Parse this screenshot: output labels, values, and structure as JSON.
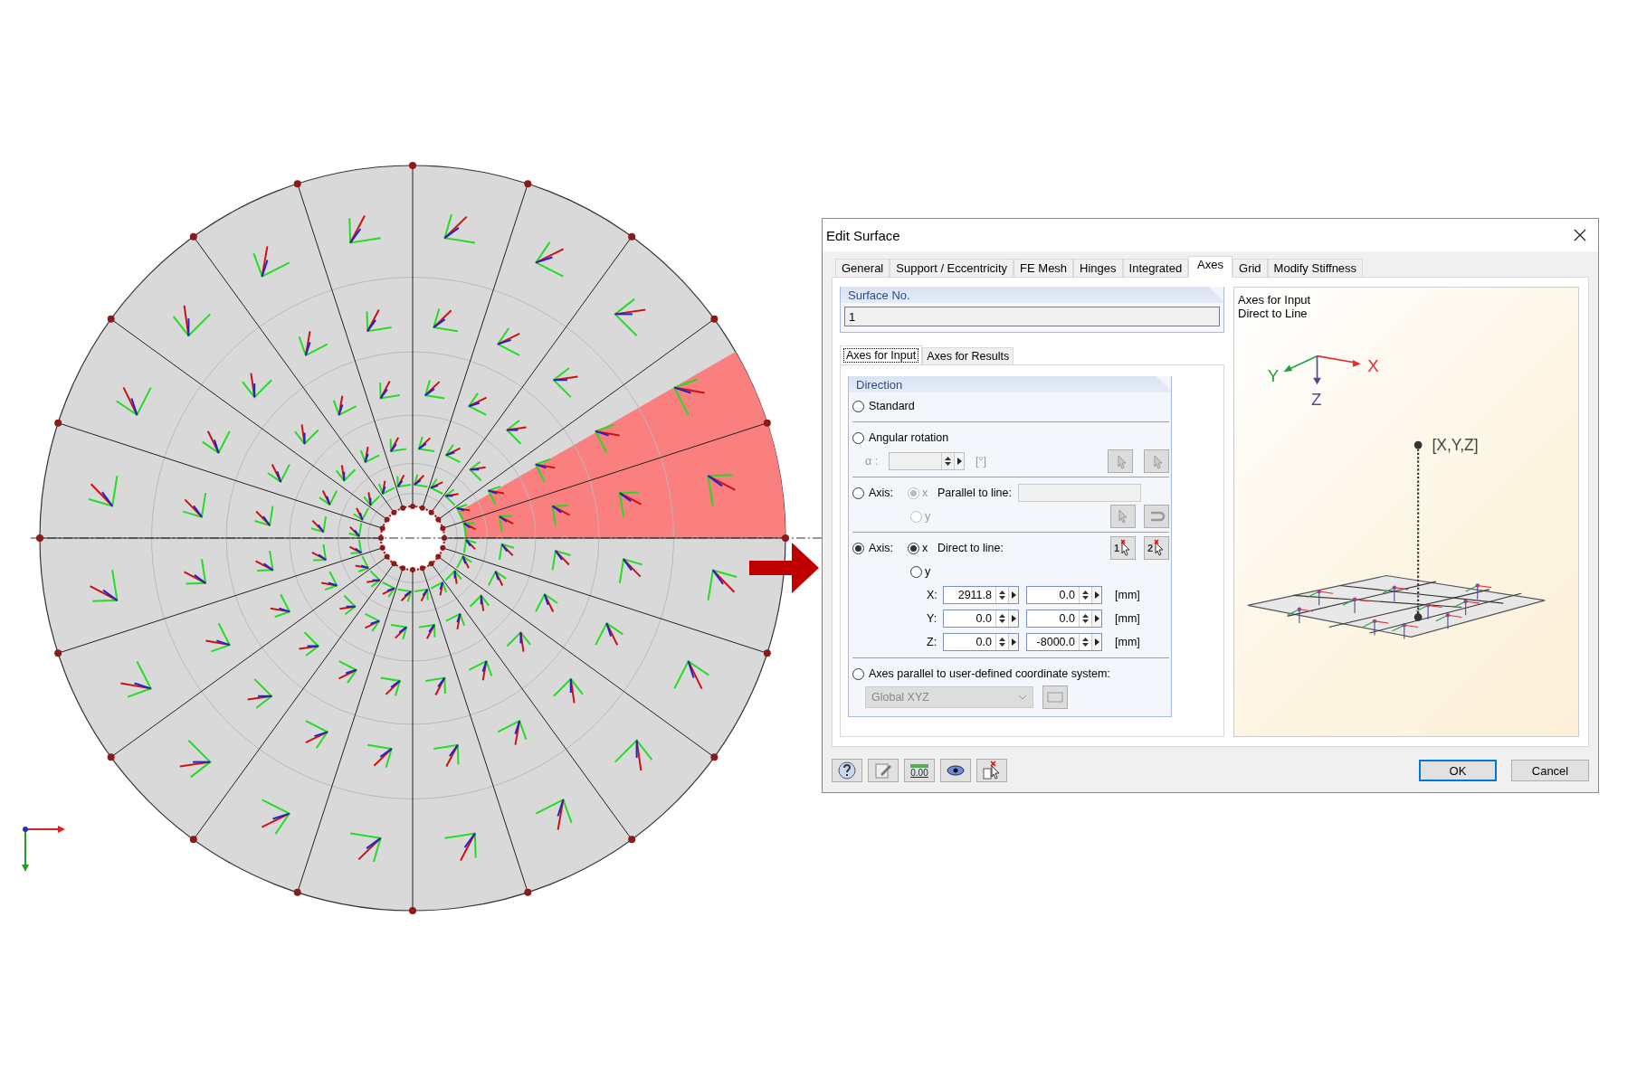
{
  "window": {
    "title": "Edit Surface"
  },
  "tabs": [
    {
      "label": "General",
      "selected": false
    },
    {
      "label": "Support / Eccentricity",
      "selected": false
    },
    {
      "label": "FE Mesh",
      "selected": false
    },
    {
      "label": "Hinges",
      "selected": false
    },
    {
      "label": "Integrated",
      "selected": false
    },
    {
      "label": "Axes",
      "selected": true
    },
    {
      "label": "Grid",
      "selected": false
    },
    {
      "label": "Modify Stiffness",
      "selected": false
    }
  ],
  "surface_no": {
    "label": "Surface No.",
    "value": "1"
  },
  "subtabs": [
    {
      "label": "Axes for Input",
      "selected": true
    },
    {
      "label": "Axes for Results",
      "selected": false
    }
  ],
  "direction": {
    "title": "Direction",
    "options": [
      {
        "kind": "simple",
        "label": "Standard",
        "selected": false
      },
      {
        "kind": "angle",
        "label": "Angular rotation",
        "selected": false,
        "angle_label": "α :",
        "unit": "[°]"
      },
      {
        "kind": "axis_parallel",
        "label": "Axis:",
        "selected": false,
        "line_label": "Parallel to line:",
        "sub_options": [
          {
            "label": "x",
            "selected": true,
            "disabled": true
          },
          {
            "label": "y",
            "selected": false,
            "disabled": true
          }
        ]
      },
      {
        "kind": "axis_direct",
        "label": "Axis:",
        "selected": true,
        "line_label": "Direct to line:",
        "pick_labels": [
          "1",
          "2"
        ],
        "sub_options": [
          {
            "label": "x",
            "selected": true,
            "disabled": false
          },
          {
            "label": "y",
            "selected": false,
            "disabled": false
          }
        ],
        "coords": [
          {
            "label": "X:",
            "values": [
              "2911.8",
              "0.0"
            ],
            "unit": "[mm]"
          },
          {
            "label": "Y:",
            "values": [
              "0.0",
              "0.0"
            ],
            "unit": "[mm]"
          },
          {
            "label": "Z:",
            "values": [
              "0.0",
              "-8000.0"
            ],
            "unit": "[mm]"
          }
        ]
      },
      {
        "kind": "coordinate_system",
        "label": "Axes parallel to user-defined coordinate system:",
        "selected": false,
        "system": "Global XYZ"
      }
    ]
  },
  "preview": {
    "lines": [
      "Axes for Input",
      "Direct to Line"
    ],
    "axis_labels": [
      "X",
      "Y",
      "Z"
    ],
    "point_label": "[X,Y,Z]"
  },
  "toolbar": [
    {
      "kind": "help"
    },
    {
      "kind": "edit"
    },
    {
      "kind": "units",
      "text": "0.00"
    },
    {
      "kind": "view"
    },
    {
      "kind": "pick"
    }
  ],
  "buttons": [
    {
      "label": "OK",
      "default": true
    },
    {
      "label": "Cancel",
      "default": false
    }
  ]
}
